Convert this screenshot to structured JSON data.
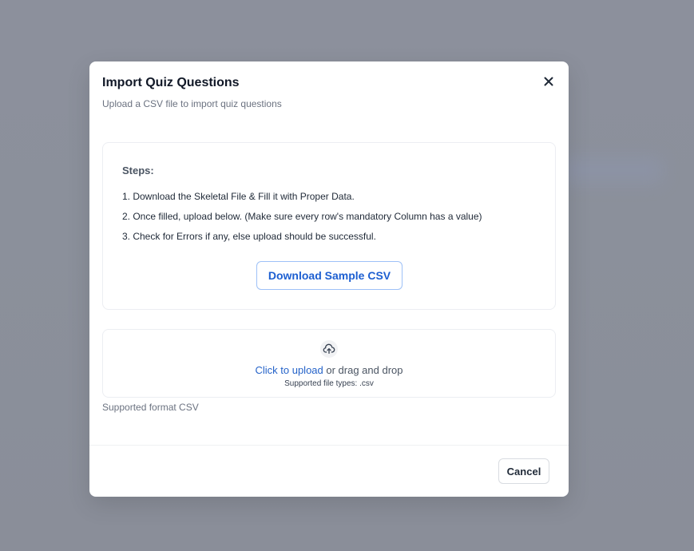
{
  "dialog": {
    "title": "Import Quiz Questions",
    "subtitle": "Upload a CSV file to import quiz questions",
    "close_icon": "close-icon"
  },
  "steps": {
    "heading": "Steps:",
    "items": [
      "1. Download the Skeletal File & Fill it with Proper Data.",
      "2. Once filled, upload below. (Make sure every row's mandatory Column has a value)",
      "3. Check for Errors if any, else upload should be successful."
    ],
    "download_label": "Download Sample CSV"
  },
  "upload": {
    "icon": "cloud-upload-icon",
    "link_text": "Click to upload",
    "rest_text": " or drag and drop",
    "types_text": "Supported file types: .csv",
    "format_note": "Supported format CSV"
  },
  "footer": {
    "cancel_label": "Cancel"
  },
  "colors": {
    "overlay": "#8a8f9c",
    "accent": "#2563c9",
    "download_border": "#9ec1f7"
  }
}
